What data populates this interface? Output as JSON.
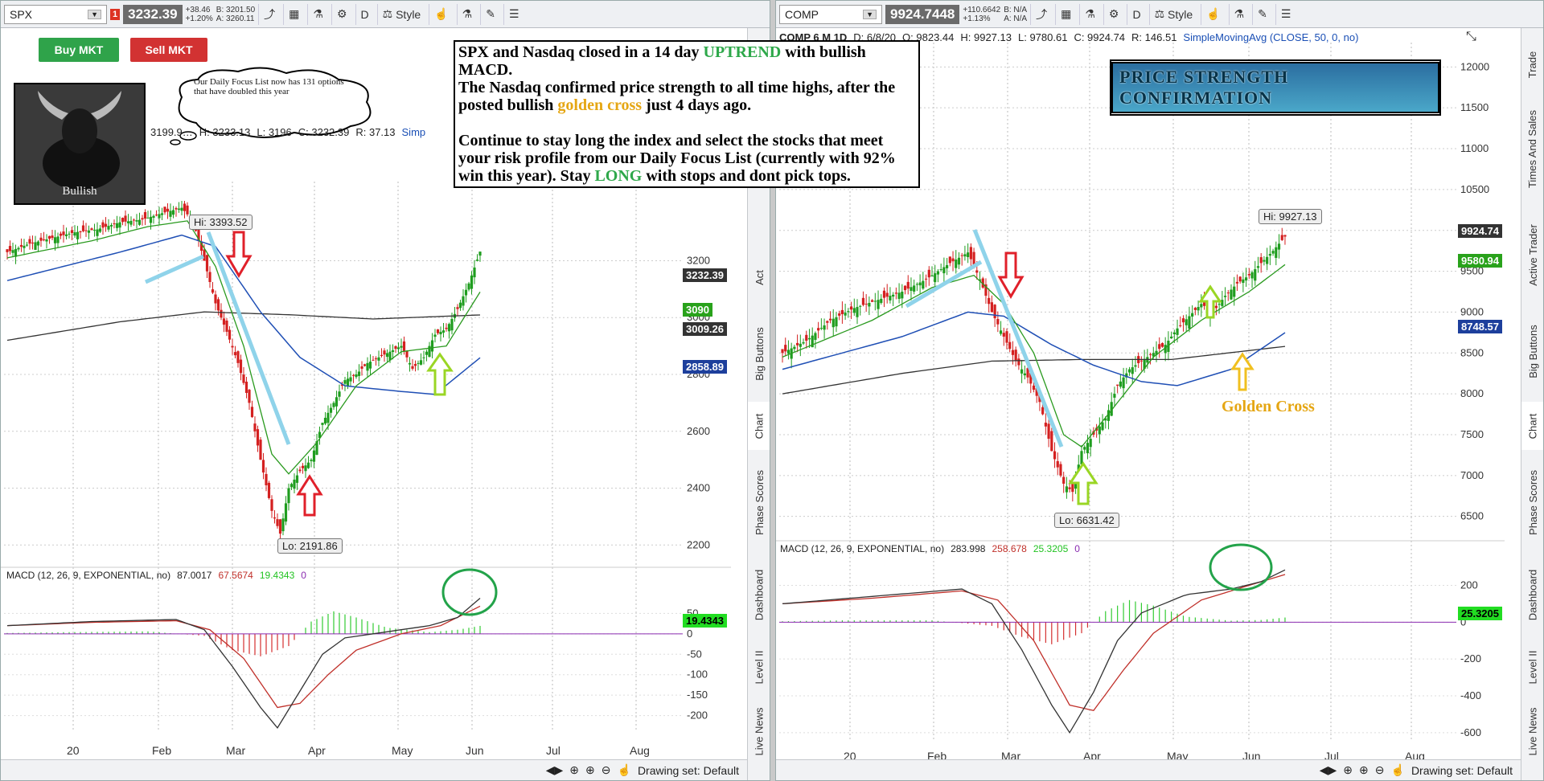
{
  "left": {
    "symbol": "SPX",
    "alert_badge": "1",
    "last": "3232.39",
    "change": "+38.46",
    "change_pct": "+1.20%",
    "bid": "B: 3201.50",
    "ask": "A: 3260.11",
    "tb_d": "D",
    "tb_style": "Style",
    "buy_label": "Buy MKT",
    "sell_label": "Sell MKT",
    "cloud_text": "Our Daily Focus List now has 131 options that have doubled this year",
    "bull_caption": "Bullish",
    "info": [
      "3199.9…",
      "H: 3233.13",
      "L: 3196",
      "C: 3232.39",
      "R: 37.13",
      "Simp"
    ],
    "hi_label": "Hi: 3393.52",
    "lo_label": "Lo: 2191.86",
    "tags": {
      "last": "3232.39",
      "sma20": "3090",
      "sma200": "3009.26",
      "sma50": "2858.89",
      "hist": "19.4343"
    },
    "macd_header": {
      "name": "MACD (12, 26, 9, EXPONENTIAL, no)",
      "v1": "87.0017",
      "v2": "67.5674",
      "v3": "19.4343",
      "v4": "0"
    },
    "drawing_set": "Drawing set: Default",
    "side_tabs": [
      "Act",
      "Big Buttons",
      "Chart",
      "Phase Scores",
      "Dashboard",
      "Level II",
      "Live News"
    ]
  },
  "right": {
    "symbol": "COMP",
    "last": "9924.7448",
    "change": "+110.6642",
    "change_pct": "+1.13%",
    "bid": "B: N/A",
    "ask": "A: N/A",
    "tb_d": "D",
    "tb_style": "Style",
    "info": [
      "COMP 6 M 1D",
      "D: 6/8/20",
      "O: 9823.44",
      "H: 9927.13",
      "L: 9780.61",
      "C: 9924.74",
      "R: 146.51",
      "SimpleMovingAvg (CLOSE, 50, 0, no)"
    ],
    "hi_label": "Hi: 9927.13",
    "lo_label": "Lo: 6631.42",
    "golden_cross": "Golden Cross",
    "psc_banner": "PRICE STRENGTH CONFIRMATION",
    "tags": {
      "last": "9924.74",
      "sma20": "9580.94",
      "sma50": "8748.57",
      "hist": "25.3205"
    },
    "macd_header": {
      "name": "MACD (12, 26, 9, EXPONENTIAL, no)",
      "v1": "283.998",
      "v2": "258.678",
      "v3": "25.3205",
      "v4": "0"
    },
    "drawing_set": "Drawing set: Default",
    "side_tabs": [
      "Trade",
      "Times And Sales",
      "Active Trader",
      "Big Buttons",
      "Chart",
      "Phase Scores",
      "Dashboard",
      "Level II",
      "Live News"
    ]
  },
  "annotation": {
    "p1a": "SPX and Nasdaq closed in a 14 day ",
    "p1b": "UPTREND",
    "p1c": " with bullish MACD.",
    "p2a": "The Nasdaq confirmed price strength to all time highs, after the posted bullish ",
    "p2b": "golden cross",
    "p2c": " just 4 days ago.",
    "p3a": "Continue to stay long the index and select the stocks that meet your risk profile from our Daily Focus List (currently with 92% win this year).  Stay ",
    "p3b": "LONG",
    "p3c": " with stops and dont pick tops."
  },
  "chart_data": [
    {
      "type": "candlestick",
      "symbol": "SPX",
      "x_ticks": [
        "20",
        "Feb",
        "Mar",
        "Apr",
        "May",
        "Jun",
        "Jul",
        "Aug"
      ],
      "y_ticks": [
        2200,
        2400,
        2600,
        2800,
        3000,
        3200
      ],
      "ylim": [
        2150,
        3450
      ],
      "close_path": [
        [
          0,
          3230
        ],
        [
          8,
          3260
        ],
        [
          16,
          3280
        ],
        [
          24,
          3300
        ],
        [
          32,
          3310
        ],
        [
          40,
          3335
        ],
        [
          48,
          3345
        ],
        [
          56,
          3370
        ],
        [
          62,
          3386
        ],
        [
          66,
          3340
        ],
        [
          70,
          3200
        ],
        [
          74,
          3050
        ],
        [
          78,
          2950
        ],
        [
          82,
          2840
        ],
        [
          86,
          2700
        ],
        [
          90,
          2500
        ],
        [
          94,
          2320
        ],
        [
          97,
          2240
        ],
        [
          100,
          2400
        ],
        [
          104,
          2460
        ],
        [
          108,
          2500
        ],
        [
          112,
          2630
        ],
        [
          116,
          2700
        ],
        [
          120,
          2780
        ],
        [
          124,
          2800
        ],
        [
          128,
          2840
        ],
        [
          132,
          2860
        ],
        [
          136,
          2880
        ],
        [
          140,
          2900
        ],
        [
          144,
          2820
        ],
        [
          148,
          2860
        ],
        [
          152,
          2940
        ],
        [
          156,
          2960
        ],
        [
          160,
          3030
        ],
        [
          164,
          3120
        ],
        [
          168,
          3232
        ]
      ],
      "sma20": [
        [
          0,
          3210
        ],
        [
          30,
          3270
        ],
        [
          50,
          3320
        ],
        [
          64,
          3340
        ],
        [
          74,
          3180
        ],
        [
          84,
          2900
        ],
        [
          94,
          2520
        ],
        [
          100,
          2450
        ],
        [
          110,
          2560
        ],
        [
          124,
          2760
        ],
        [
          140,
          2880
        ],
        [
          156,
          2900
        ],
        [
          168,
          3090
        ]
      ],
      "sma50": [
        [
          0,
          3130
        ],
        [
          40,
          3230
        ],
        [
          62,
          3290
        ],
        [
          74,
          3250
        ],
        [
          90,
          3020
        ],
        [
          104,
          2860
        ],
        [
          120,
          2760
        ],
        [
          140,
          2740
        ],
        [
          152,
          2730
        ],
        [
          168,
          2858.89
        ]
      ],
      "sma200": [
        [
          0,
          2920
        ],
        [
          40,
          2985
        ],
        [
          70,
          3020
        ],
        [
          100,
          3010
        ],
        [
          130,
          2995
        ],
        [
          168,
          3009.26
        ]
      ],
      "macd": {
        "y_ticks": [
          50,
          0,
          -50,
          -100,
          -150,
          -200
        ],
        "ylim": [
          -240,
          90
        ],
        "macd": [
          [
            0,
            20
          ],
          [
            30,
            30
          ],
          [
            60,
            35
          ],
          [
            70,
            10
          ],
          [
            80,
            -80
          ],
          [
            90,
            -180
          ],
          [
            96,
            -230
          ],
          [
            104,
            -140
          ],
          [
            112,
            -50
          ],
          [
            120,
            -10
          ],
          [
            135,
            5
          ],
          [
            150,
            20
          ],
          [
            160,
            40
          ],
          [
            168,
            87
          ]
        ],
        "signal": [
          [
            0,
            20
          ],
          [
            30,
            28
          ],
          [
            60,
            32
          ],
          [
            72,
            10
          ],
          [
            84,
            -60
          ],
          [
            96,
            -180
          ],
          [
            104,
            -170
          ],
          [
            114,
            -100
          ],
          [
            124,
            -40
          ],
          [
            140,
            0
          ],
          [
            154,
            20
          ],
          [
            168,
            67.6
          ]
        ],
        "hist": [
          [
            0,
            2
          ],
          [
            20,
            4
          ],
          [
            50,
            6
          ],
          [
            70,
            -5
          ],
          [
            80,
            -40
          ],
          [
            90,
            -55
          ],
          [
            100,
            -30
          ],
          [
            108,
            30
          ],
          [
            116,
            55
          ],
          [
            124,
            40
          ],
          [
            135,
            15
          ],
          [
            150,
            4
          ],
          [
            160,
            10
          ],
          [
            168,
            19.4
          ]
        ]
      }
    },
    {
      "type": "candlestick",
      "symbol": "COMP",
      "x_ticks": [
        "20",
        "Feb",
        "Mar",
        "Apr",
        "May",
        "Jun",
        "Jul",
        "Aug"
      ],
      "y_ticks": [
        6500,
        7000,
        7500,
        8000,
        8500,
        9000,
        9500,
        10000,
        10500,
        11000,
        11500,
        12000
      ],
      "ylim": [
        6300,
        12200
      ],
      "close_path": [
        [
          0,
          8500
        ],
        [
          8,
          8650
        ],
        [
          16,
          8900
        ],
        [
          24,
          9050
        ],
        [
          32,
          9150
        ],
        [
          40,
          9250
        ],
        [
          48,
          9400
        ],
        [
          56,
          9600
        ],
        [
          62,
          9730
        ],
        [
          66,
          9400
        ],
        [
          70,
          9000
        ],
        [
          74,
          8700
        ],
        [
          78,
          8400
        ],
        [
          82,
          8200
        ],
        [
          86,
          7900
        ],
        [
          90,
          7300
        ],
        [
          94,
          6900
        ],
        [
          97,
          6800
        ],
        [
          100,
          7300
        ],
        [
          104,
          7500
        ],
        [
          108,
          7700
        ],
        [
          112,
          8100
        ],
        [
          116,
          8300
        ],
        [
          120,
          8400
        ],
        [
          124,
          8500
        ],
        [
          128,
          8600
        ],
        [
          132,
          8800
        ],
        [
          136,
          8950
        ],
        [
          140,
          9100
        ],
        [
          144,
          9000
        ],
        [
          148,
          9200
        ],
        [
          152,
          9350
        ],
        [
          156,
          9450
        ],
        [
          160,
          9600
        ],
        [
          164,
          9750
        ],
        [
          168,
          9924
        ]
      ],
      "sma20": [
        [
          0,
          8450
        ],
        [
          30,
          8900
        ],
        [
          50,
          9300
        ],
        [
          64,
          9450
        ],
        [
          74,
          9100
        ],
        [
          84,
          8500
        ],
        [
          94,
          7500
        ],
        [
          100,
          7350
        ],
        [
          110,
          7800
        ],
        [
          124,
          8450
        ],
        [
          140,
          8900
        ],
        [
          156,
          9250
        ],
        [
          168,
          9580.94
        ]
      ],
      "sma50": [
        [
          0,
          8300
        ],
        [
          40,
          8700
        ],
        [
          62,
          9000
        ],
        [
          74,
          8950
        ],
        [
          90,
          8600
        ],
        [
          104,
          8350
        ],
        [
          120,
          8150
        ],
        [
          132,
          8100
        ],
        [
          150,
          8300
        ],
        [
          168,
          8748.57
        ]
      ],
      "sma200": [
        [
          0,
          8000
        ],
        [
          40,
          8250
        ],
        [
          70,
          8400
        ],
        [
          100,
          8420
        ],
        [
          130,
          8420
        ],
        [
          168,
          8580
        ]
      ],
      "macd": {
        "y_ticks": [
          200,
          0,
          -200,
          -400,
          -600
        ],
        "ylim": [
          -640,
          320
        ],
        "macd": [
          [
            0,
            100
          ],
          [
            30,
            140
          ],
          [
            60,
            180
          ],
          [
            70,
            100
          ],
          [
            80,
            -150
          ],
          [
            90,
            -450
          ],
          [
            96,
            -600
          ],
          [
            104,
            -380
          ],
          [
            112,
            -100
          ],
          [
            120,
            50
          ],
          [
            135,
            150
          ],
          [
            150,
            180
          ],
          [
            160,
            220
          ],
          [
            168,
            284
          ]
        ],
        "signal": [
          [
            0,
            100
          ],
          [
            30,
            130
          ],
          [
            60,
            170
          ],
          [
            72,
            120
          ],
          [
            84,
            -100
          ],
          [
            96,
            -450
          ],
          [
            104,
            -480
          ],
          [
            114,
            -260
          ],
          [
            124,
            -60
          ],
          [
            140,
            120
          ],
          [
            154,
            190
          ],
          [
            168,
            258.7
          ]
        ],
        "hist": [
          [
            0,
            5
          ],
          [
            20,
            10
          ],
          [
            50,
            10
          ],
          [
            70,
            -20
          ],
          [
            80,
            -80
          ],
          [
            90,
            -120
          ],
          [
            100,
            -60
          ],
          [
            108,
            60
          ],
          [
            116,
            120
          ],
          [
            124,
            90
          ],
          [
            135,
            30
          ],
          [
            150,
            8
          ],
          [
            160,
            12
          ],
          [
            168,
            25.3
          ]
        ]
      }
    }
  ]
}
